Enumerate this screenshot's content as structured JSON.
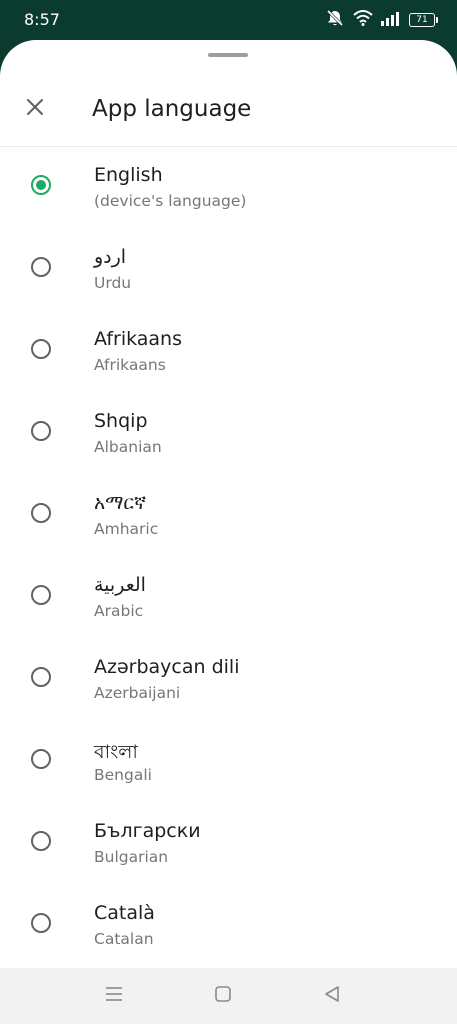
{
  "status_bar": {
    "time": "8:57",
    "battery": "71",
    "icons": [
      "mute-icon",
      "wifi-icon",
      "signal-icon",
      "battery-icon"
    ]
  },
  "header": {
    "title": "App language",
    "close_icon": "close-icon"
  },
  "languages": [
    {
      "native": "English",
      "sub": "(device's language)",
      "selected": true
    },
    {
      "native": "اردو",
      "sub": "Urdu",
      "selected": false
    },
    {
      "native": "Afrikaans",
      "sub": "Afrikaans",
      "selected": false
    },
    {
      "native": "Shqip",
      "sub": "Albanian",
      "selected": false
    },
    {
      "native": "አማርኛ",
      "sub": "Amharic",
      "selected": false
    },
    {
      "native": "العربية",
      "sub": "Arabic",
      "selected": false
    },
    {
      "native": "Azərbaycan dili",
      "sub": "Azerbaijani",
      "selected": false
    },
    {
      "native": "বাংলা",
      "sub": "Bengali",
      "selected": false
    },
    {
      "native": "Български",
      "sub": "Bulgarian",
      "selected": false
    },
    {
      "native": "Català",
      "sub": "Catalan",
      "selected": false
    }
  ],
  "nav_bar": {
    "icons": [
      "menu-icon",
      "home-icon",
      "back-icon"
    ]
  },
  "colors": {
    "accent": "#1daa61",
    "status_bar_bg": "#0b3b2e"
  }
}
